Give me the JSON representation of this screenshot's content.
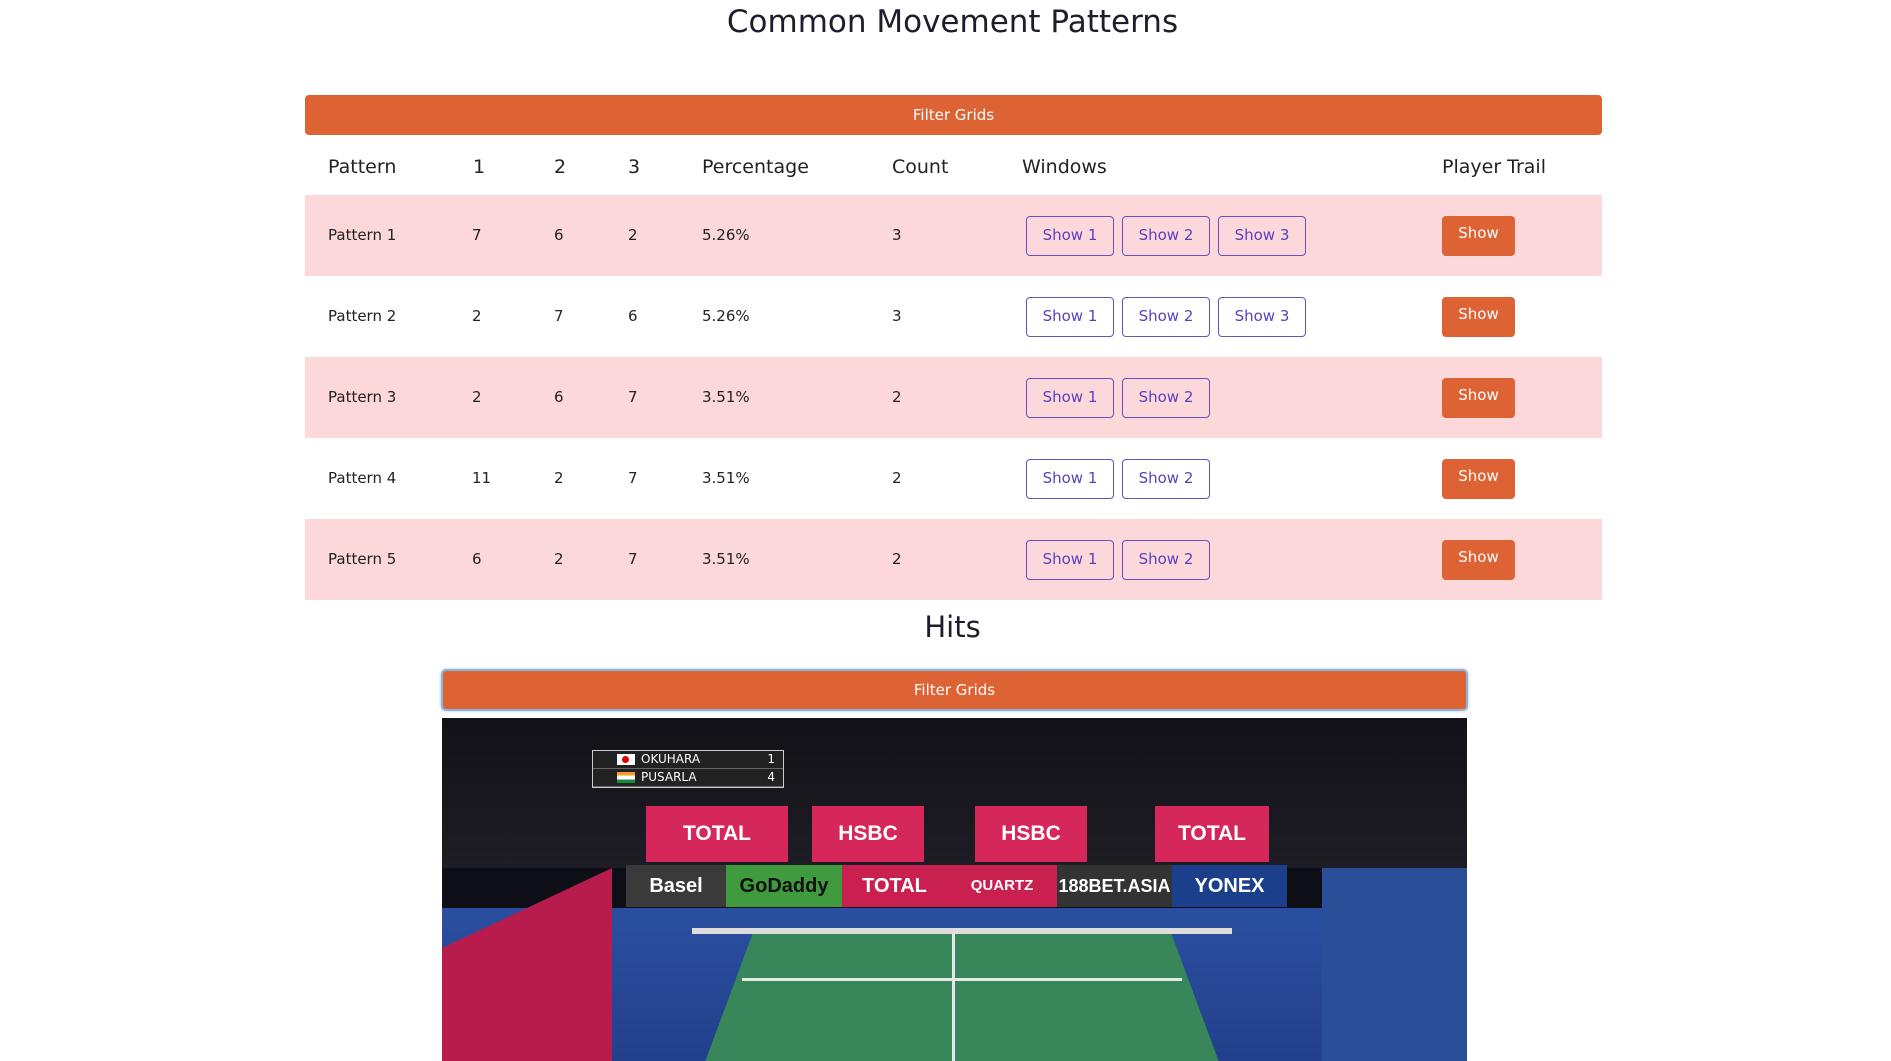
{
  "patterns_section": {
    "title": "Common Movement Patterns",
    "filter_label": "Filter Grids",
    "columns": [
      "Pattern",
      "1",
      "2",
      "3",
      "Percentage",
      "Count",
      "Windows",
      "Player Trail"
    ],
    "rows": [
      {
        "pattern": "Pattern 1",
        "c1": "7",
        "c2": "6",
        "c3": "2",
        "percentage": "5.26%",
        "count": "3",
        "windows": [
          "Show 1",
          "Show 2",
          "Show 3"
        ],
        "trail": "Show"
      },
      {
        "pattern": "Pattern 2",
        "c1": "2",
        "c2": "7",
        "c3": "6",
        "percentage": "5.26%",
        "count": "3",
        "windows": [
          "Show 1",
          "Show 2",
          "Show 3"
        ],
        "trail": "Show"
      },
      {
        "pattern": "Pattern 3",
        "c1": "2",
        "c2": "6",
        "c3": "7",
        "percentage": "3.51%",
        "count": "2",
        "windows": [
          "Show 1",
          "Show 2"
        ],
        "trail": "Show"
      },
      {
        "pattern": "Pattern 4",
        "c1": "11",
        "c2": "2",
        "c3": "7",
        "percentage": "3.51%",
        "count": "2",
        "windows": [
          "Show 1",
          "Show 2"
        ],
        "trail": "Show"
      },
      {
        "pattern": "Pattern 5",
        "c1": "6",
        "c2": "2",
        "c3": "7",
        "percentage": "3.51%",
        "count": "2",
        "windows": [
          "Show 1",
          "Show 2"
        ],
        "trail": "Show"
      }
    ]
  },
  "hits_section": {
    "title": "Hits",
    "filter_label": "Filter Grids",
    "video": {
      "scoreboard": [
        {
          "name": "OKUHARA",
          "score": "1"
        },
        {
          "name": "PUSARLA",
          "score": "4"
        }
      ],
      "ads": [
        "TOTAL",
        "HSBC",
        "HSBC",
        "TOTAL",
        "Basel",
        "GoDaddy",
        "TOTAL",
        "QUARTZ",
        "188BET.ASIA",
        "YONEX"
      ]
    }
  },
  "colors": {
    "accent": "#dd6334",
    "row_alt": "#fcd8da",
    "outline_button": "#5a3fc0"
  }
}
